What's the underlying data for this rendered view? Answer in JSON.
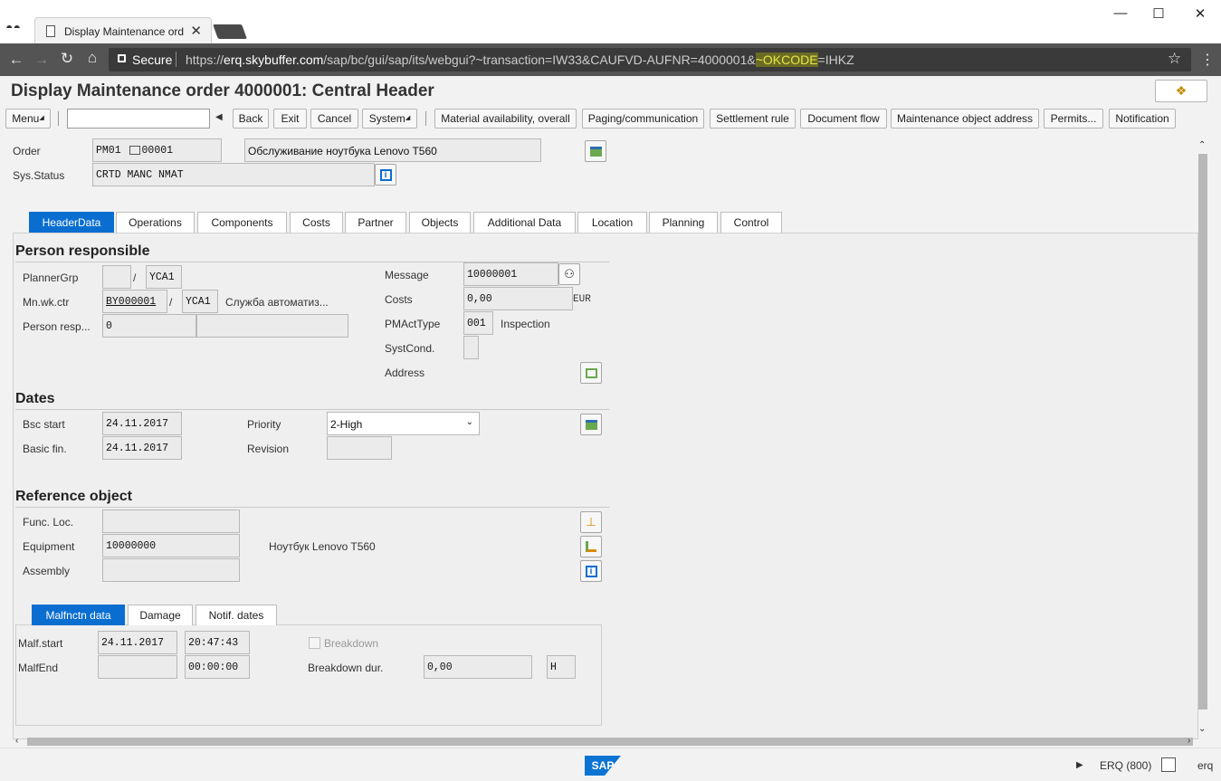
{
  "browser": {
    "tab_title": "Display Maintenance ord",
    "tab_close": "✕",
    "secure_label": "Secure",
    "url_scheme": "https://",
    "url_host": "erq.skybuffer.com",
    "url_path": "/sap/bc/gui/sap/its/webgui?~transaction=IW33&CAUFVD-AUFNR=4000001&",
    "url_highlight": "~OKCODE",
    "url_tail": "=IHKZ",
    "minimize": "—",
    "maximize": "☐",
    "close": "✕",
    "back": "←",
    "forward": "→",
    "reload": "↻",
    "home": "⌂",
    "star": "☆",
    "menu": "⋮"
  },
  "header": {
    "title": "Display Maintenance order 4000001: Central Header"
  },
  "toolbar": {
    "menu": "Menu",
    "back": "Back",
    "exit": "Exit",
    "cancel": "Cancel",
    "system": "System",
    "material_availability": "Material availability, overall",
    "paging": "Paging/communication",
    "settlement": "Settlement rule",
    "document_flow": "Document flow",
    "maint_object_address": "Maintenance object address",
    "permits": "Permits...",
    "notification": "Notification"
  },
  "order": {
    "order_label": "Order",
    "order_type": "PM01",
    "order_number": "00001",
    "description": "Обслуживание ноутбука Lenovo T560",
    "sys_status_label": "Sys.Status",
    "sys_status": "CRTD MANC NMAT"
  },
  "tabs": [
    "HeaderData",
    "Operations",
    "Components",
    "Costs",
    "Partner",
    "Objects",
    "Additional Data",
    "Location",
    "Planning",
    "Control"
  ],
  "person_responsible": {
    "title": "Person responsible",
    "planner_grp_label": "PlannerGrp",
    "planner_grp": "",
    "planner_plant": "YCA1",
    "mn_wk_ctr_label": "Mn.wk.ctr",
    "mn_wk_ctr": "BY000001",
    "mn_wk_ctr_plant": "YCA1",
    "mn_wk_ctr_desc": "Служба автоматиз...",
    "person_resp_label": "Person resp...",
    "person_resp": "0",
    "message_label": "Message",
    "message": "10000001",
    "costs_label": "Costs",
    "costs": "0,00",
    "costs_currency": "EUR",
    "pmacttype_label": "PMActType",
    "pmacttype": "001",
    "pmacttype_desc": "Inspection",
    "systcond_label": "SystCond.",
    "address_label": "Address"
  },
  "dates": {
    "title": "Dates",
    "bsc_start_label": "Bsc start",
    "bsc_start": "24.11.2017",
    "basic_fin_label": "Basic fin.",
    "basic_fin": "24.11.2017",
    "priority_label": "Priority",
    "priority": "2-High",
    "revision_label": "Revision"
  },
  "reference": {
    "title": "Reference object",
    "func_loc_label": "Func. Loc.",
    "equipment_label": "Equipment",
    "equipment": "10000000",
    "equipment_desc": "Ноутбук Lenovo T560",
    "assembly_label": "Assembly"
  },
  "subtabs": [
    "Malfnctn data",
    "Damage",
    "Notif. dates"
  ],
  "malfunction": {
    "malf_start_label": "Malf.start",
    "malf_start_date": "24.11.2017",
    "malf_start_time": "20:47:43",
    "malf_end_label": "MalfEnd",
    "malf_end_time": "00:00:00",
    "breakdown_label": "Breakdown",
    "breakdown_dur_label": "Breakdown dur.",
    "breakdown_dur": "0,00",
    "breakdown_unit": "H"
  },
  "status_bar": {
    "system": "ERQ (800)",
    "server": "erq",
    "logo": "SAP"
  }
}
